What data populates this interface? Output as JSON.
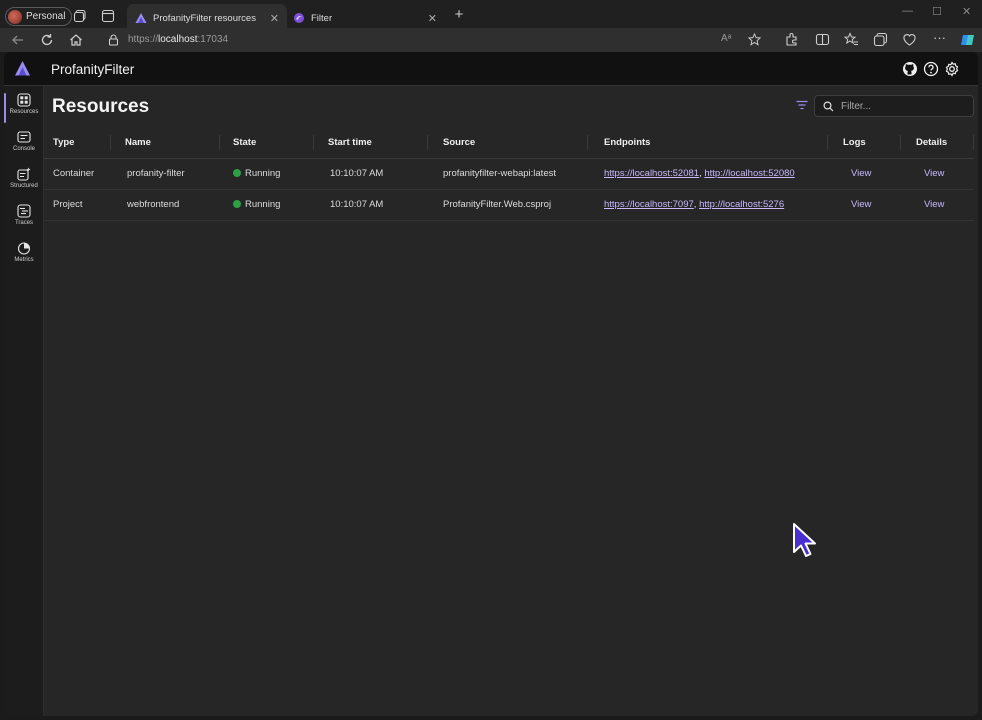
{
  "browser": {
    "profile_label": "Personal",
    "tabs": [
      {
        "title": "ProfanityFilter resources",
        "active": true
      },
      {
        "title": "Filter",
        "active": false
      }
    ],
    "url_prefix": "https://",
    "url_host": "localhost",
    "url_rest": ":17034"
  },
  "app": {
    "title": "ProfanityFilter",
    "accent": "#9a8cf0"
  },
  "sidenav": [
    {
      "label": "Resources",
      "icon": "grid-icon",
      "active": true
    },
    {
      "label": "Console",
      "icon": "console-icon",
      "active": false
    },
    {
      "label": "Structured",
      "icon": "structured-logs-icon",
      "active": false
    },
    {
      "label": "Traces",
      "icon": "traces-icon",
      "active": false
    },
    {
      "label": "Metrics",
      "icon": "metrics-icon",
      "active": false
    }
  ],
  "page": {
    "title": "Resources",
    "filter_placeholder": "Filter..."
  },
  "table": {
    "columns": [
      "Type",
      "Name",
      "State",
      "Start time",
      "Source",
      "Endpoints",
      "Logs",
      "Details"
    ],
    "rows": [
      {
        "type": "Container",
        "name": "profanity-filter",
        "state": "Running",
        "start_time": "10:10:07 AM",
        "source": "profanityfilter-webapi:latest",
        "endpoint1": "https://localhost:52081",
        "endpoint2": "http://localhost:52080",
        "logs": "View",
        "details": "View"
      },
      {
        "type": "Project",
        "name": "webfrontend",
        "state": "Running",
        "start_time": "10:10:07 AM",
        "source": "ProfanityFilter.Web.csproj",
        "endpoint1": "https://localhost:7097",
        "endpoint2": "http://localhost:5276",
        "logs": "View",
        "details": "View"
      }
    ]
  }
}
